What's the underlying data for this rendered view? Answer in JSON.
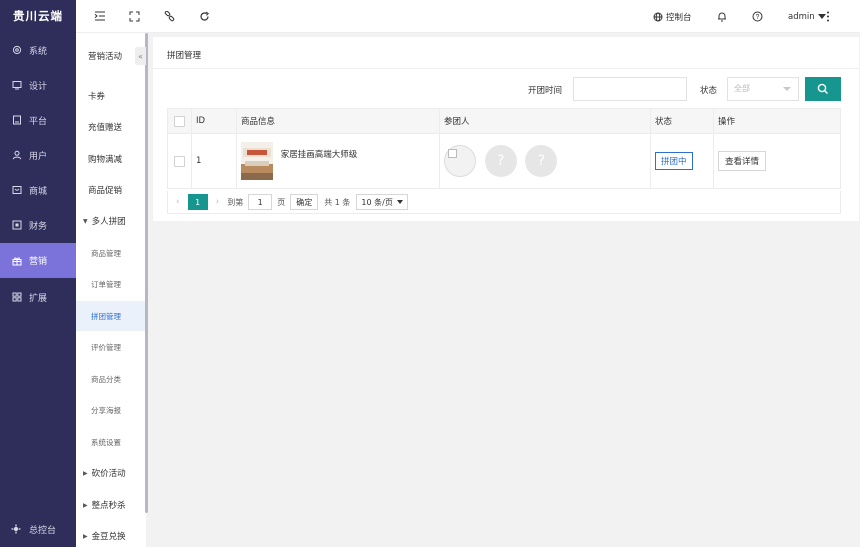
{
  "brand": "贵川云端",
  "nav": {
    "items": [
      {
        "label": "系统",
        "icon": "gear-icon"
      },
      {
        "label": "设计",
        "icon": "monitor-icon"
      },
      {
        "label": "平台",
        "icon": "monitor-icon"
      },
      {
        "label": "用户",
        "icon": "user-icon"
      },
      {
        "label": "商城",
        "icon": "shop-icon"
      },
      {
        "label": "财务",
        "icon": "wallet-icon"
      },
      {
        "label": "营销",
        "icon": "gift-icon"
      },
      {
        "label": "扩展",
        "icon": "grid-icon"
      }
    ],
    "active": "营销",
    "bottom_label": "总控台"
  },
  "subnav": {
    "items": [
      {
        "label": "营销活动"
      },
      {
        "label": "卡券"
      },
      {
        "label": "充值赠送"
      },
      {
        "label": "购物满减"
      },
      {
        "label": "商品促销"
      },
      {
        "label": "多人拼团"
      },
      {
        "label": "商品管理"
      },
      {
        "label": "订单管理"
      },
      {
        "label": "拼团管理"
      },
      {
        "label": "评价管理"
      },
      {
        "label": "商品分类"
      },
      {
        "label": "分享海报"
      },
      {
        "label": "系统设置"
      },
      {
        "label": "砍价活动"
      },
      {
        "label": "整点秒杀"
      },
      {
        "label": "金豆兑换"
      }
    ],
    "collapse_glyph": "«"
  },
  "topbar": {
    "dashboard_label": "控制台",
    "user_label": "admin"
  },
  "panel": {
    "title": "拼团管理",
    "filter": {
      "time_label": "开团时间",
      "time_value": "",
      "status_label": "状态",
      "status_value": "全部"
    },
    "table": {
      "headers": [
        "ID",
        "商品信息",
        "参团人",
        "状态",
        "操作"
      ],
      "rows": [
        {
          "id": "1",
          "goods": "家居挂画高端大师级",
          "status": "拼团中",
          "action": "查看详情",
          "avatar_placeholder": "?"
        }
      ]
    },
    "pager": {
      "current_page": "1",
      "goto_label": "到第",
      "goto_value": "1",
      "page_unit": "页",
      "confirm_label": "确定",
      "total": "共 1 条",
      "page_size": "10 条/页"
    }
  },
  "colors": {
    "nav_bg": "#2f2e5b",
    "nav_active": "#7b73d9",
    "accent": "#16968f",
    "link_blue": "#2f6fd1"
  }
}
